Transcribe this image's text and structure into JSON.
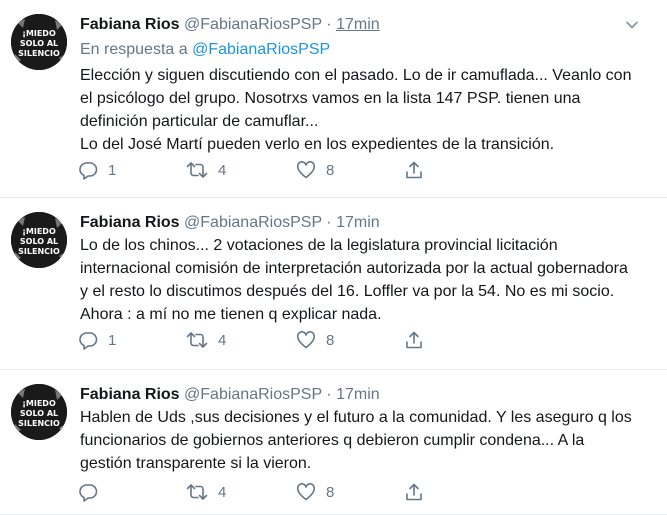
{
  "tweets": [
    {
      "fullname": "Fabiana Rios",
      "handle": "@FabianaRiosPSP",
      "dot": "·",
      "time": "17min",
      "reply_prefix": "En respuesta a",
      "reply_handle": "@FabianaRiosPSP",
      "text": "Elección y siguen discutiendo con el pasado. Lo de ir camuflada... Veanlo con\nel psicólogo del grupo. Nosotrxs vamos en la lista 147 PSP. tienen una\ndefinición particular de camuflar...\nLo del José Martí pueden verlo en los expedientes de la transición.",
      "replies": "1",
      "retweets": "4",
      "likes": "8"
    },
    {
      "fullname": "Fabiana Rios",
      "handle": "@FabianaRiosPSP",
      "dot": "·",
      "time": "17min",
      "text": "Lo de los chinos... 2 votaciones de la legislatura provincial licitación\ninternacional comisión de interpretación autorizada por la actual gobernadora\ny  el resto lo discutimos después del 16. Loffler va por la 54. No es mi socio.\nAhora : a mí no me tienen q explicar nada.",
      "replies": "1",
      "retweets": "4",
      "likes": "8"
    },
    {
      "fullname": "Fabiana Rios",
      "handle": "@FabianaRiosPSP",
      "dot": "·",
      "time": "17min",
      "text": "Hablen de Uds ,sus decisiones y el futuro a la comunidad. Y les aseguro q los\nfuncionarios  de gobiernos anteriores q debieron cumplir condena... A la\ngestión transparente si la vieron.",
      "replies": "",
      "retweets": "4",
      "likes": "8"
    }
  ],
  "avatar_text": [
    "¡MIEDO",
    "SOLO AL",
    "SILENCIO"
  ],
  "icons": {
    "reply": "reply-icon",
    "retweet": "retweet-icon",
    "like": "like-icon",
    "share": "share-icon",
    "caret": "chevron-down-icon"
  },
  "colors": {
    "name": "#14171a",
    "meta": "#657786",
    "link": "#1b95e0",
    "divider": "#e6ecf0"
  }
}
